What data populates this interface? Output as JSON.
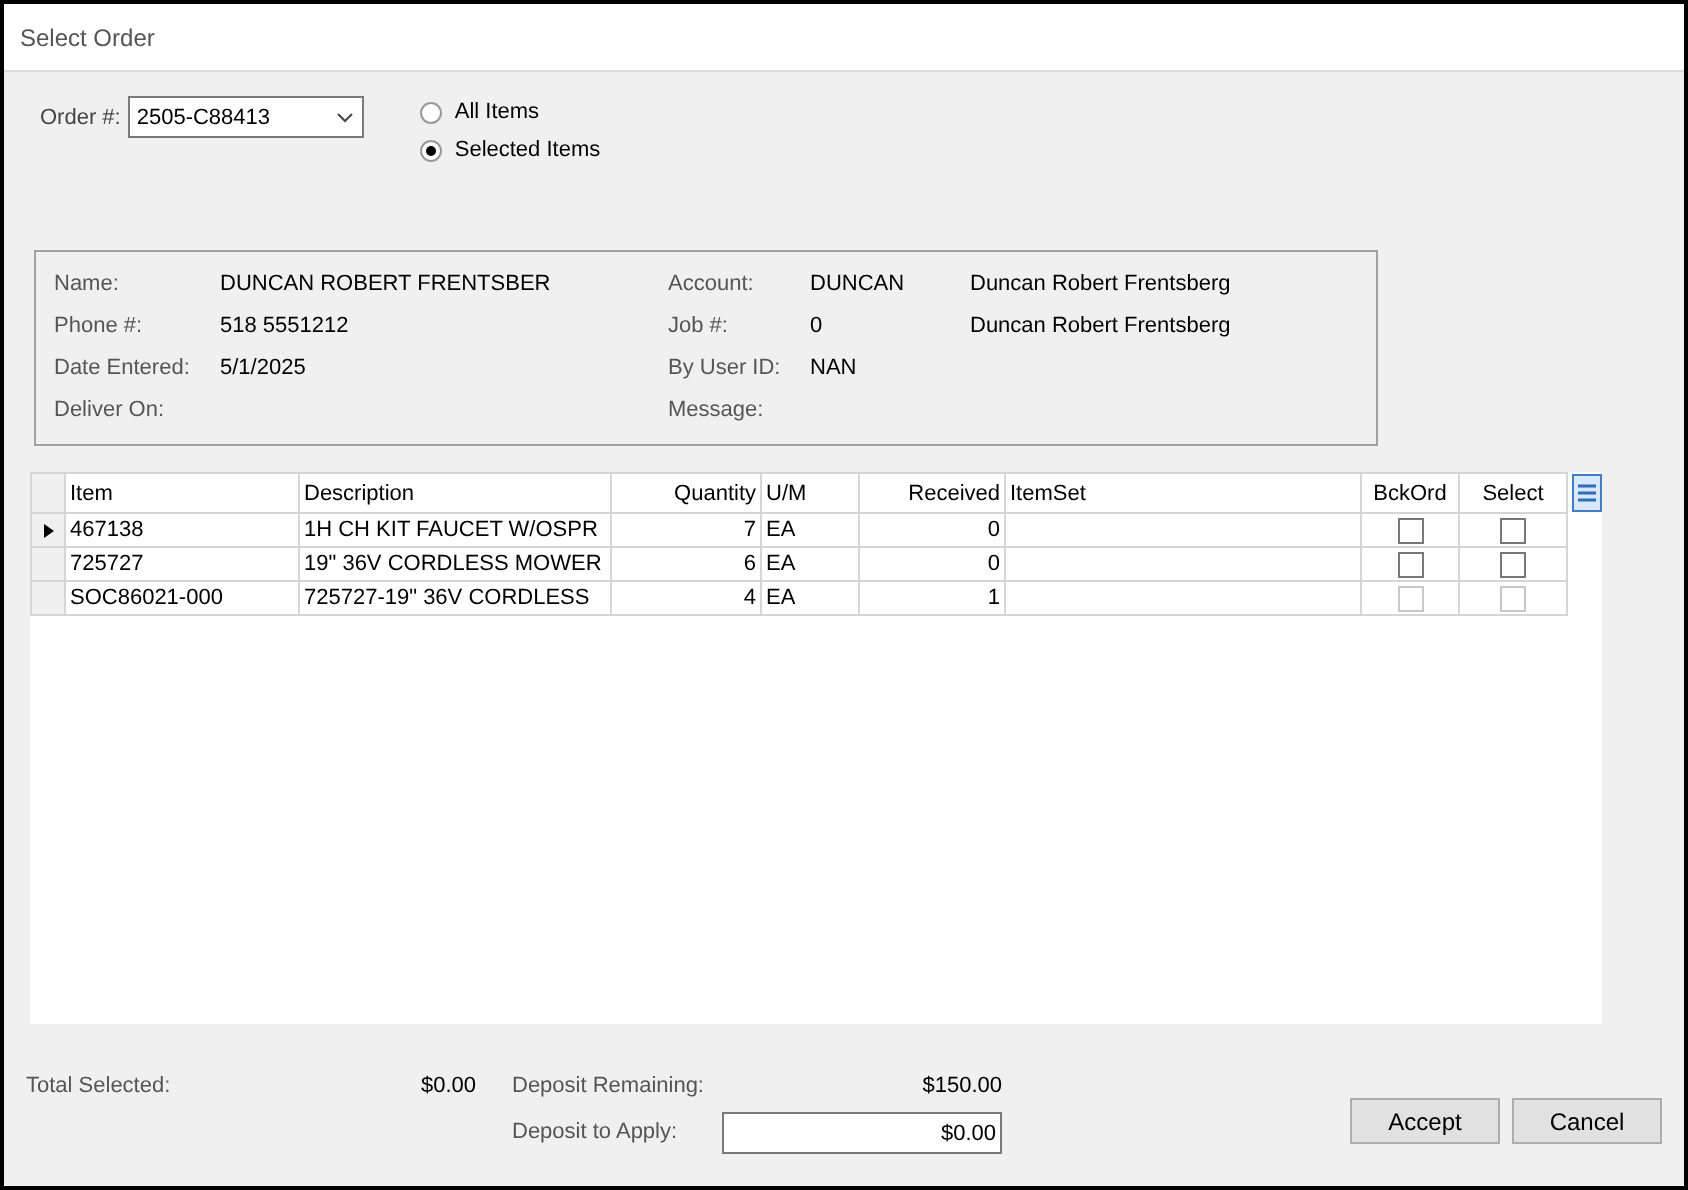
{
  "window": {
    "title": "Select Order"
  },
  "order": {
    "label": "Order #:",
    "value": "2505-C88413"
  },
  "scope_options": [
    {
      "label": "All Items",
      "selected": false
    },
    {
      "label": "Selected Items",
      "selected": true
    }
  ],
  "customer": {
    "left": [
      {
        "label": "Name:",
        "value": "DUNCAN ROBERT FRENTSBER"
      },
      {
        "label": "Phone #:",
        "value": "518 5551212"
      },
      {
        "label": "Date Entered:",
        "value": "5/1/2025"
      },
      {
        "label": "Deliver On:"
      }
    ],
    "right": [
      {
        "label": "Account:",
        "value": "DUNCAN",
        "extra": "Duncan Robert Frentsberg"
      },
      {
        "label": "Job #:",
        "value": "0",
        "extra": "Duncan Robert Frentsberg"
      },
      {
        "label": "By User ID:",
        "value": "NAN"
      },
      {
        "label": "Message:"
      }
    ]
  },
  "table": {
    "columns": [
      {
        "label": "Item"
      },
      {
        "label": "Description"
      },
      {
        "label": "Quantity"
      },
      {
        "label": "U/M"
      },
      {
        "label": "Received"
      },
      {
        "label": "ItemSet"
      },
      {
        "label": "BckOrd"
      },
      {
        "label": "Select"
      }
    ],
    "rows": [
      {
        "current": true,
        "item": "467138",
        "description": "1H CH KIT  FAUCET W/OSPR",
        "quantity": "7",
        "um": "EA",
        "received": "0",
        "bckord": false,
        "select": false,
        "disabled": false
      },
      {
        "current": false,
        "item": "725727",
        "description": "19\" 36V CORDLESS MOWER",
        "quantity": "6",
        "um": "EA",
        "received": "0",
        "bckord": false,
        "select": false,
        "disabled": false
      },
      {
        "current": false,
        "item": "SOC86021-000",
        "description": "725727-19\" 36V CORDLESS",
        "quantity": "4",
        "um": "EA",
        "received": "1",
        "bckord": false,
        "select": false,
        "disabled": true
      }
    ]
  },
  "totals": {
    "total_selected_label": "Total Selected:",
    "total_selected": "$0.00",
    "deposit_remaining_label": "Deposit Remaining:",
    "deposit_remaining": "$150.00",
    "deposit_apply_label": "Deposit to Apply:",
    "deposit_apply": "$0.00"
  },
  "buttons": [
    "Accept",
    "Cancel"
  ]
}
